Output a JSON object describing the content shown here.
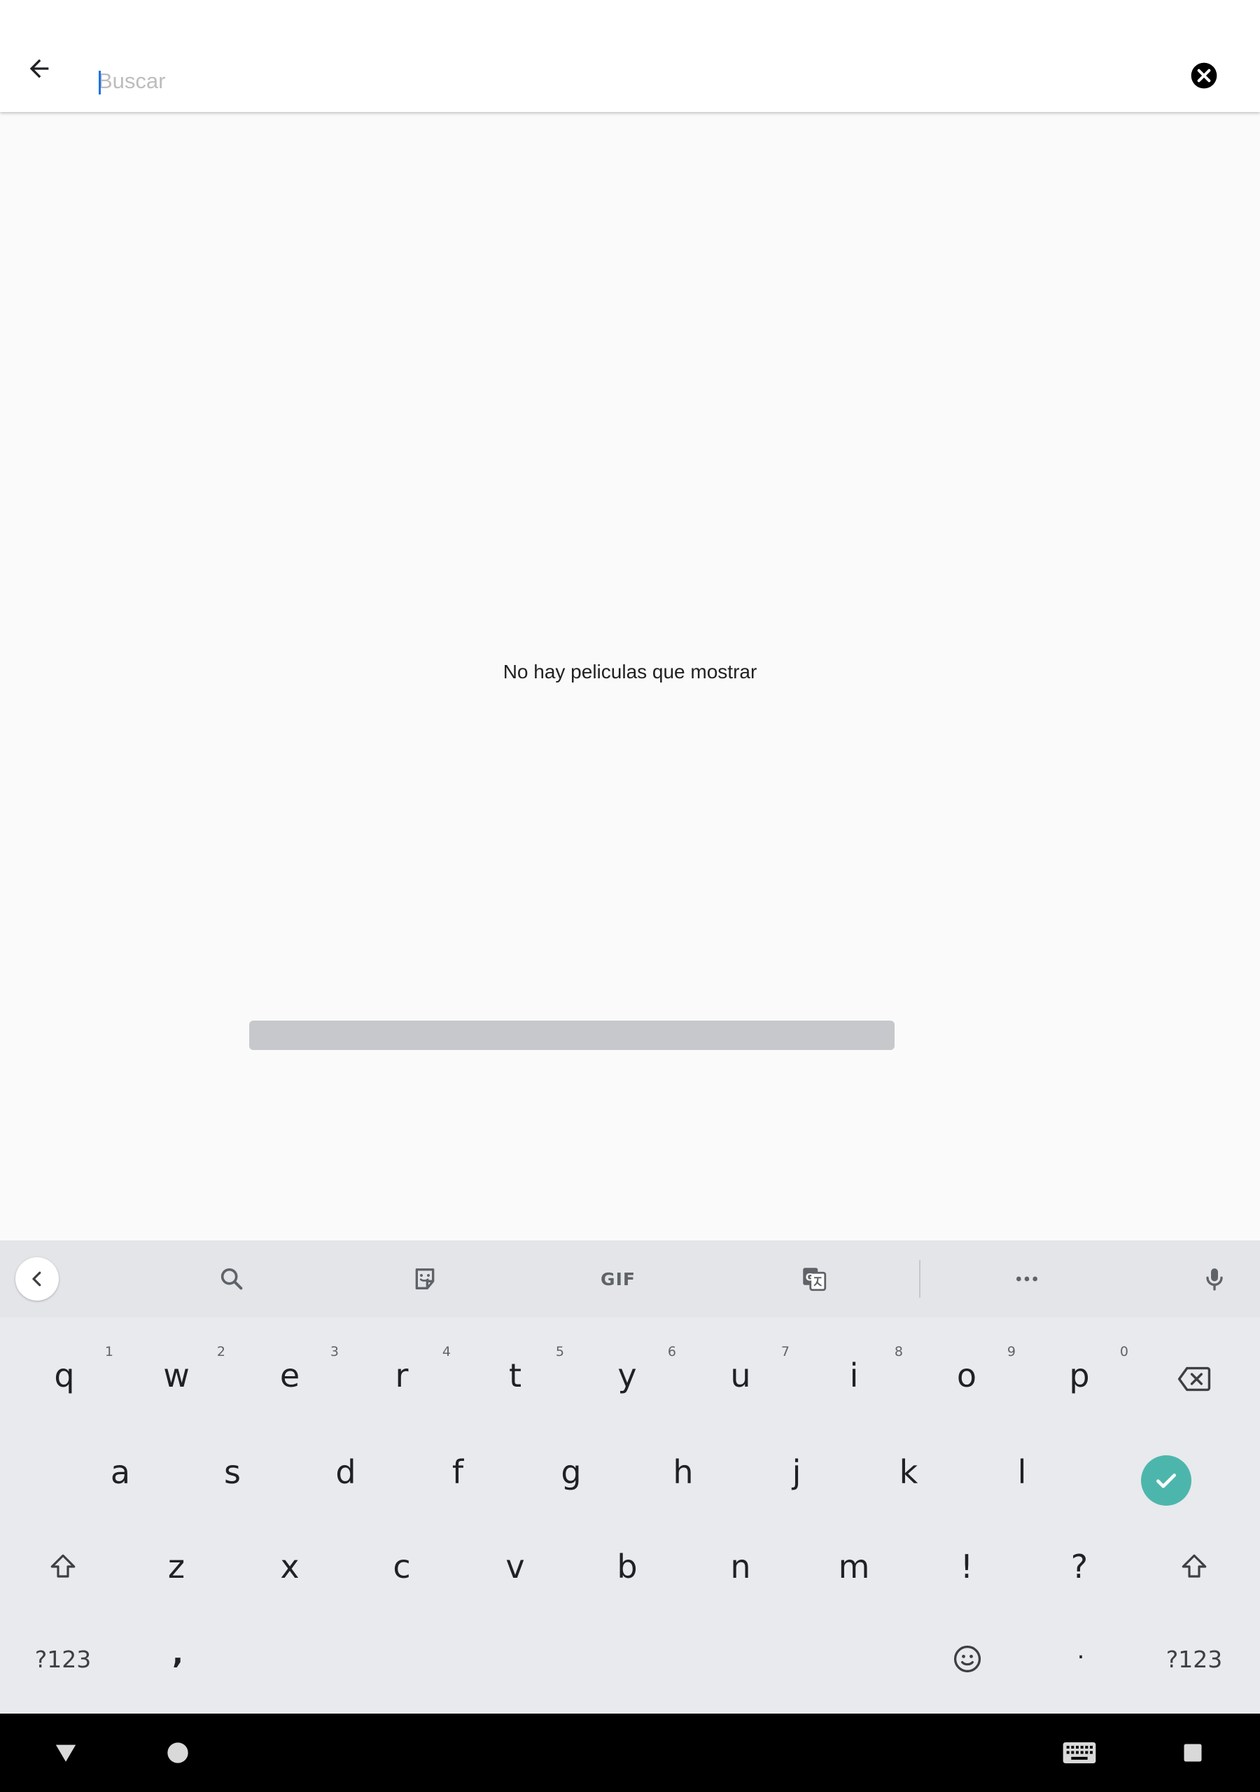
{
  "search": {
    "placeholder": "Buscar",
    "value": ""
  },
  "content": {
    "empty_message": "No hay peliculas que mostrar"
  },
  "keyboard": {
    "toolbar": {
      "items": [
        "collapse-icon",
        "search-icon",
        "sticker-icon",
        "GIF",
        "translate-icon",
        "more-icon",
        "mic-icon"
      ],
      "gif_label": "GIF"
    },
    "row1": [
      {
        "key": "q",
        "hint": "1"
      },
      {
        "key": "w",
        "hint": "2"
      },
      {
        "key": "e",
        "hint": "3"
      },
      {
        "key": "r",
        "hint": "4"
      },
      {
        "key": "t",
        "hint": "5"
      },
      {
        "key": "y",
        "hint": "6"
      },
      {
        "key": "u",
        "hint": "7"
      },
      {
        "key": "i",
        "hint": "8"
      },
      {
        "key": "o",
        "hint": "9"
      },
      {
        "key": "p",
        "hint": "0"
      }
    ],
    "row2": [
      "a",
      "s",
      "d",
      "f",
      "g",
      "h",
      "j",
      "k",
      "l"
    ],
    "row3": [
      "z",
      "x",
      "c",
      "v",
      "b",
      "n",
      "m",
      "!",
      "?"
    ],
    "row4": {
      "symbols_left": "?123",
      "comma": ",",
      "period": ".",
      "symbols_right": "?123"
    },
    "enter_color": "#4db6ac"
  },
  "navbar": {
    "items": [
      "back-icon",
      "home-icon",
      "keyboard-switch-icon",
      "recents-icon"
    ]
  }
}
